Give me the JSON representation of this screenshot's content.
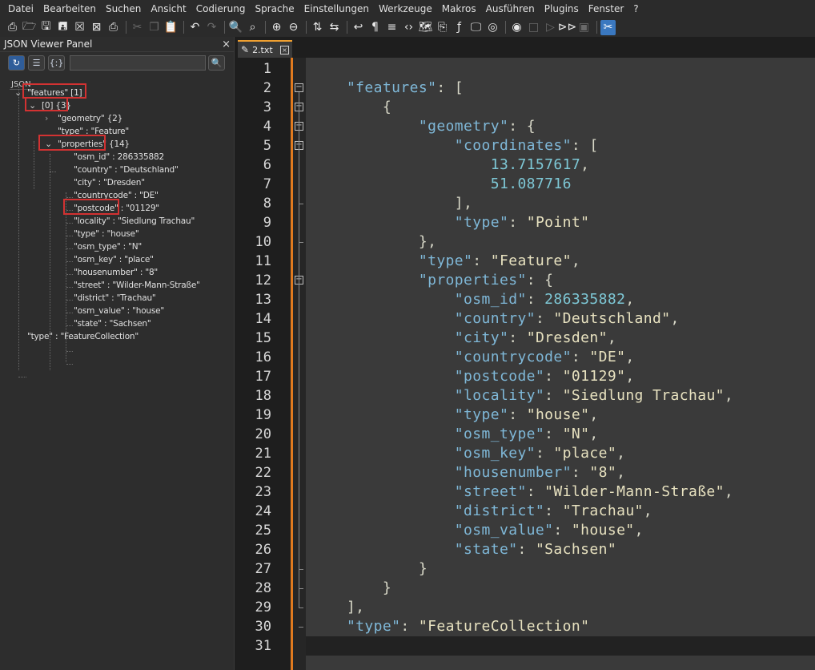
{
  "menu": [
    "Datei",
    "Bearbeiten",
    "Suchen",
    "Ansicht",
    "Codierung",
    "Sprache",
    "Einstellungen",
    "Werkzeuge",
    "Makros",
    "Ausführen",
    "Plugins",
    "Fenster",
    "?"
  ],
  "toolbar": {
    "icons": [
      "new-file-icon",
      "open-file-icon",
      "save-icon",
      "save-all-icon",
      "close-icon",
      "close-all-icon",
      "print-icon",
      "cut-icon",
      "copy-icon",
      "paste-icon",
      "undo-icon",
      "redo-icon",
      "find-icon",
      "replace-icon",
      "zoom-in-icon",
      "zoom-out-icon",
      "sync-vertical-icon",
      "sync-horizontal-icon",
      "word-wrap-icon",
      "show-all-chars-icon",
      "indent-guide-icon",
      "xml-tag-icon",
      "document-map-icon",
      "clipboard-icon",
      "function-list-icon",
      "monitor-icon",
      "folder-as-workspace-icon",
      "record-macro-icon",
      "stop-record-icon",
      "play-macro-icon",
      "run-macro-multiple-icon",
      "save-macro-icon",
      "json-viewer-icon"
    ]
  },
  "panel": {
    "title": "JSON Viewer Panel",
    "close": "×",
    "root_label": "JSON",
    "tree": [
      {
        "text": "\"features\" [1]"
      },
      {
        "text": "[0] {3}"
      },
      {
        "text": "\"geometry\" {2}"
      },
      {
        "text": "\"type\" : \"Feature\""
      },
      {
        "text": "\"properties\" {14}"
      },
      {
        "text": "\"osm_id\" : 286335882"
      },
      {
        "text": "\"country\" : \"Deutschland\""
      },
      {
        "text": "\"city\" : \"Dresden\""
      },
      {
        "text": "\"countrycode\" : \"DE\""
      },
      {
        "text": "\"postcode\" : \"01129\""
      },
      {
        "text": "\"locality\" : \"Siedlung Trachau\""
      },
      {
        "text": "\"type\" : \"house\""
      },
      {
        "text": "\"osm_type\" : \"N\""
      },
      {
        "text": "\"osm_key\" : \"place\""
      },
      {
        "text": "\"housenumber\" : \"8\""
      },
      {
        "text": "\"street\" : \"Wilder-Mann-Straße\""
      },
      {
        "text": "\"district\" : \"Trachau\""
      },
      {
        "text": "\"osm_value\" : \"house\""
      },
      {
        "text": "\"state\" : \"Sachsen\""
      },
      {
        "text": "\"type\" : \"FeatureCollection\""
      }
    ]
  },
  "tab": {
    "label": "2.txt",
    "close": "×"
  },
  "editor": {
    "lines": [
      [],
      [
        [
          "k",
          "    \"features\""
        ],
        [
          "pun",
          ": ["
        ]
      ],
      [
        [
          "pun",
          "        {"
        ]
      ],
      [
        [
          "k",
          "            \"geometry\""
        ],
        [
          "pun",
          ": {"
        ]
      ],
      [
        [
          "k",
          "                \"coordinates\""
        ],
        [
          "pun",
          ": ["
        ]
      ],
      [
        [
          "n",
          "                    13.7157617"
        ],
        [
          "pun",
          ","
        ]
      ],
      [
        [
          "n",
          "                    51.087716"
        ]
      ],
      [
        [
          "pun",
          "                ],"
        ]
      ],
      [
        [
          "k",
          "                \"type\""
        ],
        [
          "pun",
          ": "
        ],
        [
          "s",
          "\"Point\""
        ]
      ],
      [
        [
          "pun",
          "            },"
        ]
      ],
      [
        [
          "k",
          "            \"type\""
        ],
        [
          "pun",
          ": "
        ],
        [
          "s",
          "\"Feature\""
        ],
        [
          "pun",
          ","
        ]
      ],
      [
        [
          "k",
          "            \"properties\""
        ],
        [
          "pun",
          ": {"
        ]
      ],
      [
        [
          "k",
          "                \"osm_id\""
        ],
        [
          "pun",
          ": "
        ],
        [
          "n",
          "286335882"
        ],
        [
          "pun",
          ","
        ]
      ],
      [
        [
          "k",
          "                \"country\""
        ],
        [
          "pun",
          ": "
        ],
        [
          "s",
          "\"Deutschland\""
        ],
        [
          "pun",
          ","
        ]
      ],
      [
        [
          "k",
          "                \"city\""
        ],
        [
          "pun",
          ": "
        ],
        [
          "s",
          "\"Dresden\""
        ],
        [
          "pun",
          ","
        ]
      ],
      [
        [
          "k",
          "                \"countrycode\""
        ],
        [
          "pun",
          ": "
        ],
        [
          "s",
          "\"DE\""
        ],
        [
          "pun",
          ","
        ]
      ],
      [
        [
          "k",
          "                \"postcode\""
        ],
        [
          "pun",
          ": "
        ],
        [
          "s",
          "\"01129\""
        ],
        [
          "pun",
          ","
        ]
      ],
      [
        [
          "k",
          "                \"locality\""
        ],
        [
          "pun",
          ": "
        ],
        [
          "s",
          "\"Siedlung Trachau\""
        ],
        [
          "pun",
          ","
        ]
      ],
      [
        [
          "k",
          "                \"type\""
        ],
        [
          "pun",
          ": "
        ],
        [
          "s",
          "\"house\""
        ],
        [
          "pun",
          ","
        ]
      ],
      [
        [
          "k",
          "                \"osm_type\""
        ],
        [
          "pun",
          ": "
        ],
        [
          "s",
          "\"N\""
        ],
        [
          "pun",
          ","
        ]
      ],
      [
        [
          "k",
          "                \"osm_key\""
        ],
        [
          "pun",
          ": "
        ],
        [
          "s",
          "\"place\""
        ],
        [
          "pun",
          ","
        ]
      ],
      [
        [
          "k",
          "                \"housenumber\""
        ],
        [
          "pun",
          ": "
        ],
        [
          "s",
          "\"8\""
        ],
        [
          "pun",
          ","
        ]
      ],
      [
        [
          "k",
          "                \"street\""
        ],
        [
          "pun",
          ": "
        ],
        [
          "s",
          "\"Wilder-Mann-Straße\""
        ],
        [
          "pun",
          ","
        ]
      ],
      [
        [
          "k",
          "                \"district\""
        ],
        [
          "pun",
          ": "
        ],
        [
          "s",
          "\"Trachau\""
        ],
        [
          "pun",
          ","
        ]
      ],
      [
        [
          "k",
          "                \"osm_value\""
        ],
        [
          "pun",
          ": "
        ],
        [
          "s",
          "\"house\""
        ],
        [
          "pun",
          ","
        ]
      ],
      [
        [
          "k",
          "                \"state\""
        ],
        [
          "pun",
          ": "
        ],
        [
          "s",
          "\"Sachsen\""
        ]
      ],
      [
        [
          "pun",
          "            }"
        ]
      ],
      [
        [
          "pun",
          "        }"
        ]
      ],
      [
        [
          "pun",
          "    ],"
        ]
      ],
      [
        [
          "k",
          "    \"type\""
        ],
        [
          "pun",
          ": "
        ],
        [
          "s",
          "\"FeatureCollection\""
        ]
      ],
      []
    ]
  },
  "colors": {
    "accent_orange": "#e07a1f",
    "highlight_red": "#d23232",
    "key": "#7fb8d8",
    "string": "#e8e2c0",
    "number": "#7ec8d6"
  }
}
